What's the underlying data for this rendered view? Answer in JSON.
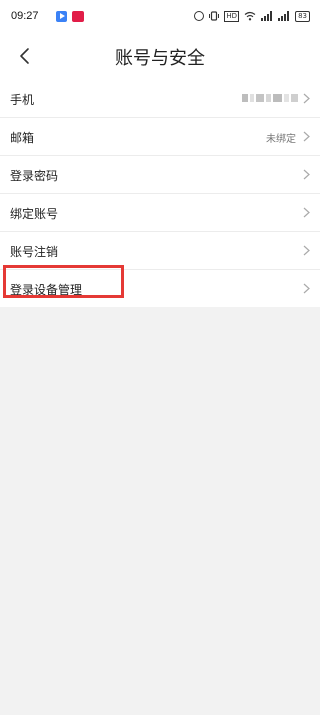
{
  "status_bar": {
    "time": "09:27",
    "hd_label": "HD",
    "battery": "83"
  },
  "header": {
    "title": "账号与安全"
  },
  "settings": {
    "items": [
      {
        "label": "手机",
        "value": "",
        "masked": true
      },
      {
        "label": "邮箱",
        "value": "未绑定"
      },
      {
        "label": "登录密码",
        "value": ""
      },
      {
        "label": "绑定账号",
        "value": ""
      },
      {
        "label": "账号注销",
        "value": ""
      },
      {
        "label": "登录设备管理",
        "value": "",
        "highlighted": true
      }
    ]
  },
  "colors": {
    "highlight": "#e53935",
    "background": "#f2f2f2",
    "text": "#222222"
  }
}
